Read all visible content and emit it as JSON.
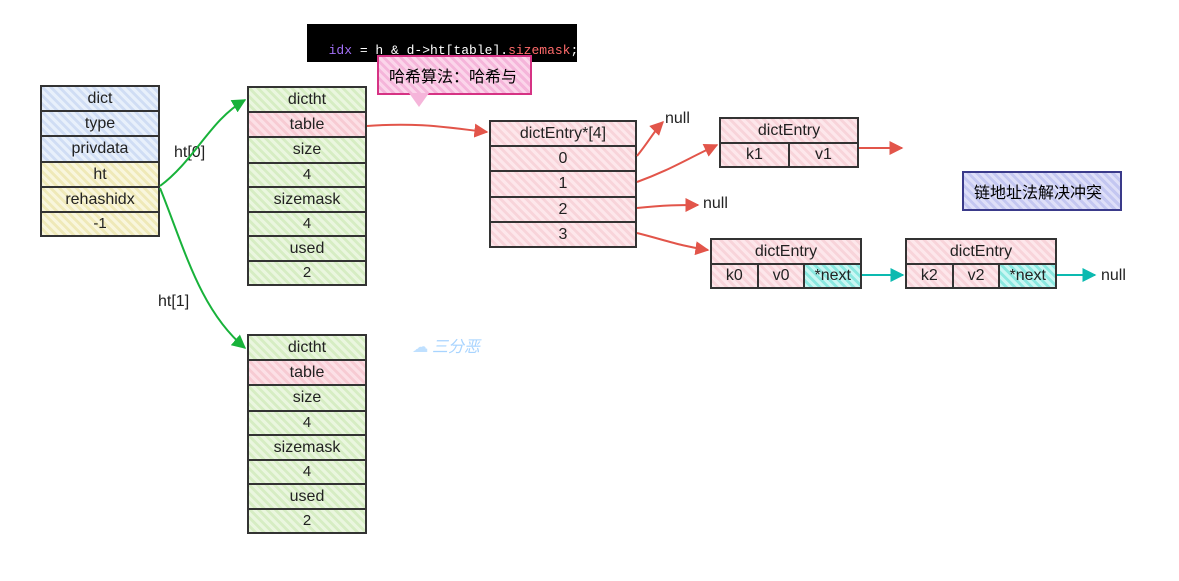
{
  "code": {
    "idx": "idx",
    "expr1": " = h & d->",
    "ht": "ht[table]",
    "dot": ".",
    "size": "sizemask",
    "semi": ";"
  },
  "callout_hash": "哈希算法：哈希与",
  "callout_chain": "链地址法解决冲突",
  "watermark": "三分恶",
  "labels": {
    "ht0": "ht[0]",
    "ht1": "ht[1]",
    "null1": "null",
    "null2": "null",
    "null3": "null"
  },
  "dict": {
    "title": "dict",
    "rows": [
      "type",
      "privdata",
      "ht",
      "rehashidx",
      "-1"
    ]
  },
  "dictht": {
    "title": "dictht",
    "table": "table",
    "size_lbl": "size",
    "size_val": "4",
    "mask_lbl": "sizemask",
    "mask_val": "4",
    "used_lbl": "used",
    "used_val": "2"
  },
  "array": {
    "title": "dictEntry*[4]",
    "slots": [
      "0",
      "1",
      "2",
      "3"
    ]
  },
  "entry1": {
    "title": "dictEntry",
    "k": "k1",
    "v": "v1"
  },
  "entry0": {
    "title": "dictEntry",
    "k": "k0",
    "v": "v0",
    "next": "*next"
  },
  "entry2": {
    "title": "dictEntry",
    "k": "k2",
    "v": "v2",
    "next": "*next"
  }
}
